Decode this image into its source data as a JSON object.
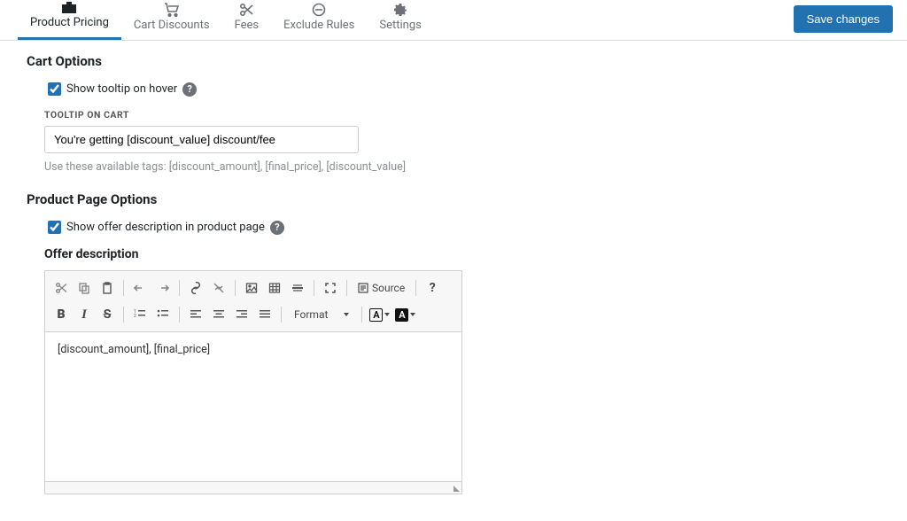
{
  "header": {
    "tabs": [
      {
        "label": "Product Pricing",
        "active": true
      },
      {
        "label": "Cart Discounts",
        "active": false
      },
      {
        "label": "Fees",
        "active": false
      },
      {
        "label": "Exclude Rules",
        "active": false
      },
      {
        "label": "Settings",
        "active": false
      }
    ],
    "save_button": "Save changes"
  },
  "cart_options": {
    "heading": "Cart Options",
    "show_tooltip": {
      "label": "Show tooltip on hover",
      "checked": true
    },
    "tooltip_field": {
      "label": "TOOLTIP ON CART",
      "value": "You're getting [discount_value] discount/fee",
      "hint": "Use these available tags: [discount_amount], [final_price], [discount_value]"
    }
  },
  "product_page_options": {
    "heading": "Product Page Options",
    "show_desc": {
      "label": "Show offer description in product page",
      "checked": true
    },
    "offer_desc": {
      "label": "Offer description"
    }
  },
  "editor": {
    "format_label": "Format",
    "source_label": "Source",
    "body_text": "[discount_amount], [final_price]"
  }
}
